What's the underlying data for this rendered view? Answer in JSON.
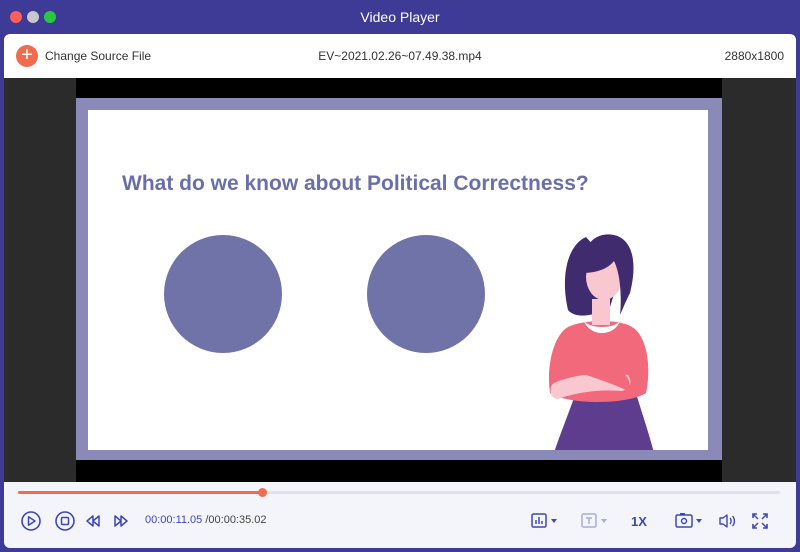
{
  "window": {
    "title": "Video Player"
  },
  "toolbar": {
    "change_source_label": "Change Source File",
    "filename": "EV~2021.02.26~07.49.38.mp4",
    "resolution": "2880x1800"
  },
  "slide": {
    "heading": "What do we know about Political Correctness?"
  },
  "playback": {
    "current_time": "00:00:11.05",
    "separator_duration": " /00:00:35.02",
    "progress_fraction": 0.32,
    "speed": "1X"
  },
  "colors": {
    "accent": "#f26b4f",
    "brand": "#3e3b97",
    "control_blue": "#3e46b8"
  },
  "icons": {
    "play": "play-icon",
    "stop": "stop-icon",
    "rewind": "rewind-icon",
    "forward": "fast-forward-icon",
    "audio_track": "audio-track-icon",
    "subtitle": "subtitle-icon",
    "snapshot": "snapshot-icon",
    "volume": "volume-icon",
    "fullscreen": "fullscreen-icon"
  }
}
